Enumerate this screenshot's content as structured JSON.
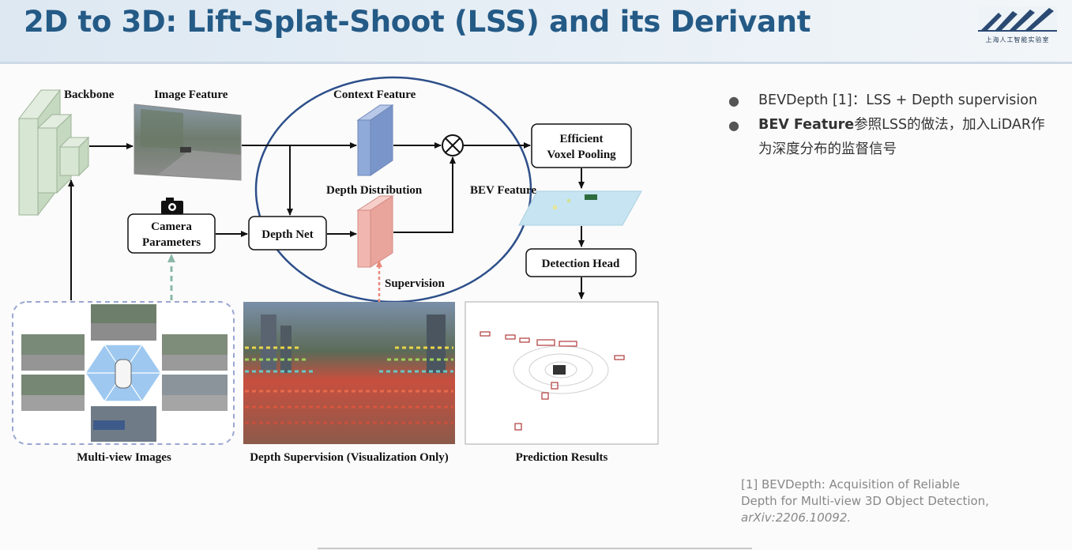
{
  "slide": {
    "title": "2D to 3D: Lift-Splat-Shoot (LSS) and its Derivant",
    "logo_text": "上海人工智能实验室"
  },
  "diagram": {
    "labels": {
      "backbone": "Backbone",
      "image_feature": "Image Feature",
      "context_feature": "Context Feature",
      "depth_distribution": "Depth Distribution",
      "bev_feature": "BEV Feature",
      "supervision": "Supervision",
      "multi_view_images": "Multi-view Images",
      "depth_supervision": "Depth Supervision (Visualization Only)",
      "prediction_results": "Prediction Results"
    },
    "boxes": {
      "camera_parameters_line1": "Camera",
      "camera_parameters_line2": "Parameters",
      "depth_net": "Depth Net",
      "efficient_line1": "Efficient",
      "efficient_line2": "Voxel Pooling",
      "detection_head": "Detection Head"
    },
    "operator": "⊗"
  },
  "bullets": [
    {
      "bold": "",
      "text": "BEVDepth [1]：LSS + Depth supervision"
    },
    {
      "bold": "BEV Feature",
      "text": "参照LSS的做法，加入LiDAR作为深度分布的监督信号"
    }
  ],
  "reference": {
    "text": "[1] BEVDepth: Acquisition of Reliable Depth for Multi-view 3D Object Detection, ",
    "italic": "arXiv:2206.10092."
  },
  "colors": {
    "title": "#245a86",
    "circle": "#2d4f8a",
    "context_feature": "#8fa9d9",
    "depth_distribution": "#f1b6b0",
    "backbone": "#d7e5d3",
    "supervision_arrow": "#e98a7c",
    "camera_arrow": "#8ab8a8"
  }
}
